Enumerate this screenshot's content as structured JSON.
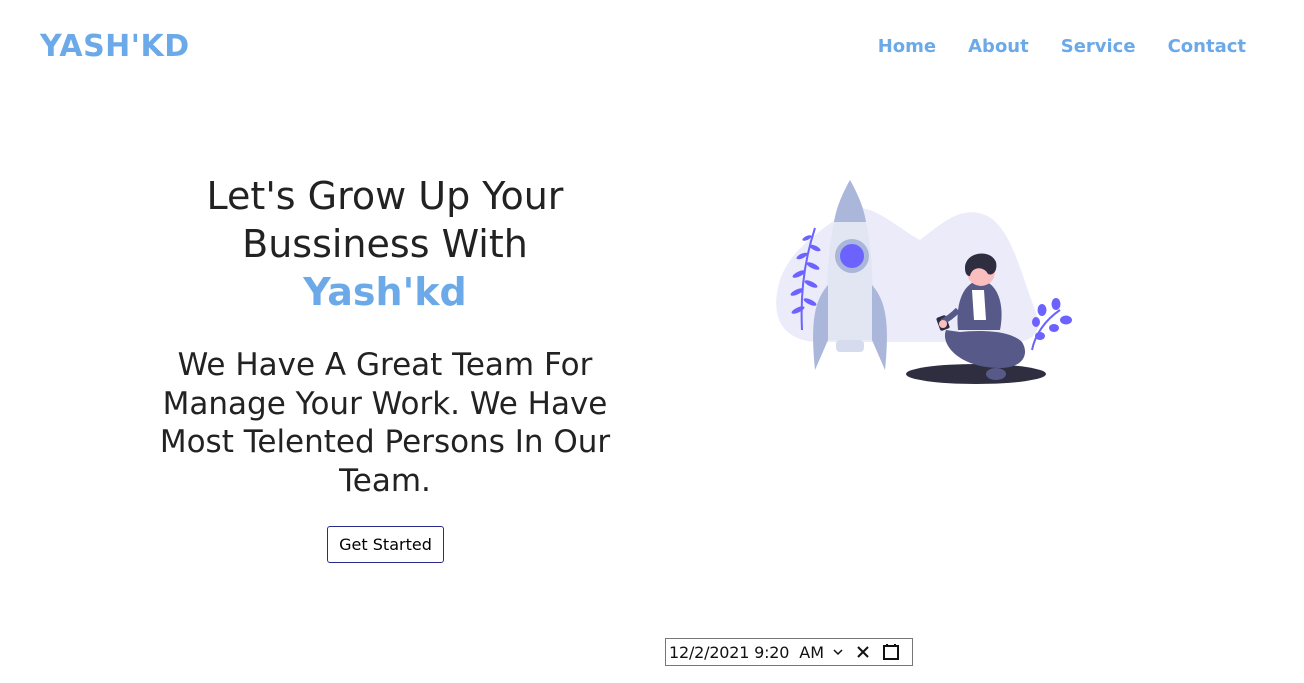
{
  "header": {
    "logo": "YASH'KD",
    "nav": [
      "Home",
      "About",
      "Service",
      "Contact"
    ]
  },
  "hero": {
    "title_line1": "Let's Grow Up Your",
    "title_line2": "Bussiness With",
    "brand": "Yash'kd",
    "subtitle": "We Have A Great Team For Manage Your Work. We Have Most Telented Persons In Our Team.",
    "cta_label": "Get Started"
  },
  "datetime_input": {
    "value": "12/2/2021 9:20",
    "ampm": "AM"
  },
  "colors": {
    "accent": "#6ba9e8",
    "text": "#222222",
    "button_border": "#2a2a8a",
    "illustration_primary": "#6c63ff",
    "illustration_dark": "#2f2e41"
  }
}
